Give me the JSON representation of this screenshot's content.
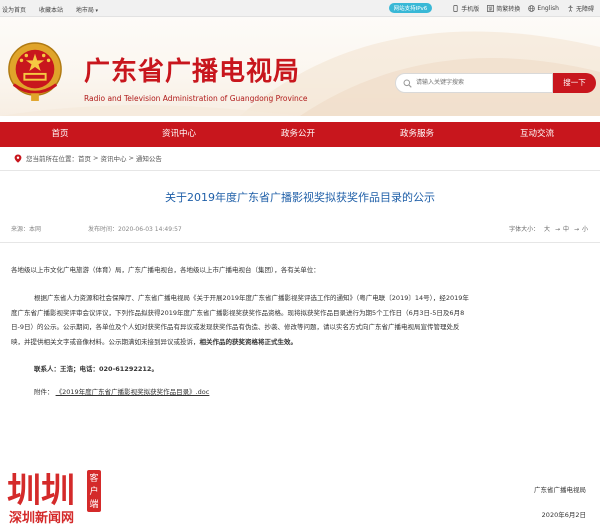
{
  "topbar": {
    "left_items": [
      "设为首页",
      "收藏本站",
      "地市局"
    ],
    "ipv6": "网站支持IPv6",
    "right_items": [
      {
        "label": "手机版",
        "icon": "mobile-icon"
      },
      {
        "label": "简繁转换",
        "icon": "translate-icon"
      },
      {
        "label": "English",
        "icon": "globe-icon"
      },
      {
        "label": "无障碍",
        "icon": "accessibility-icon"
      }
    ]
  },
  "header": {
    "title_cn": "广东省广播电视局",
    "title_en": "Radio and Television Administration of Guangdong Province",
    "search_placeholder": "请输入关键字搜索",
    "search_button": "搜一下"
  },
  "nav": [
    "首页",
    "资讯中心",
    "政务公开",
    "政务服务",
    "互动交流"
  ],
  "breadcrumb": [
    "您当前所在位置：",
    "首页",
    "资讯中心",
    "通知公告"
  ],
  "article": {
    "title": "关于2019年度广东省广播影视奖拟获奖作品目录的公示",
    "source": "来源：本网",
    "date": "发布时间：2020-06-03 14:49:57",
    "font_size_label": "字体大小：",
    "font_sizes": [
      "大",
      "中",
      "小"
    ],
    "salutation": "各地级以上市文化广电旅游（体育）局，广东广播电视台，各地级以上市广播电视台（集团），各有关单位：",
    "body_lines": [
      "根据广东省人力资源和社会保障厅、广东省广播电视局《关于开展2019年度广东省广播影视奖评选工作的通知》（粤广电联〔2019〕14号），经2019年",
      "度广东省广播影视奖评审会议评议，下列作品拟获得2019年度广东省广播影视奖获奖作品资格。现将拟获奖作品目录进行为期5个工作日（6月3日-5日及6月8",
      "日-9日）的公示。公示期间，各单位及个人如对获奖作品有异议或发现获奖作品有伪造、抄袭、修改等问题，请以实名方式向广东省广播电视局宣传管理处反",
      "映，并提供相关文字或音像材料。公示期满如未接到异议或投诉，"
    ],
    "body_bold_tail": "相关作品的获奖资格将正式生效。",
    "contact": "联系人：王浩；电话：020-61292212。",
    "attachment_label": "附件：",
    "attachment_link": "《2019年度广东省广播影视奖拟获奖作品目录》.doc",
    "signature": "广东省广播电视局",
    "sign_date": "2020年6月2日"
  },
  "watermark": {
    "brand": "深圳新闻网",
    "tag": "客户端",
    "mark": "圳"
  }
}
